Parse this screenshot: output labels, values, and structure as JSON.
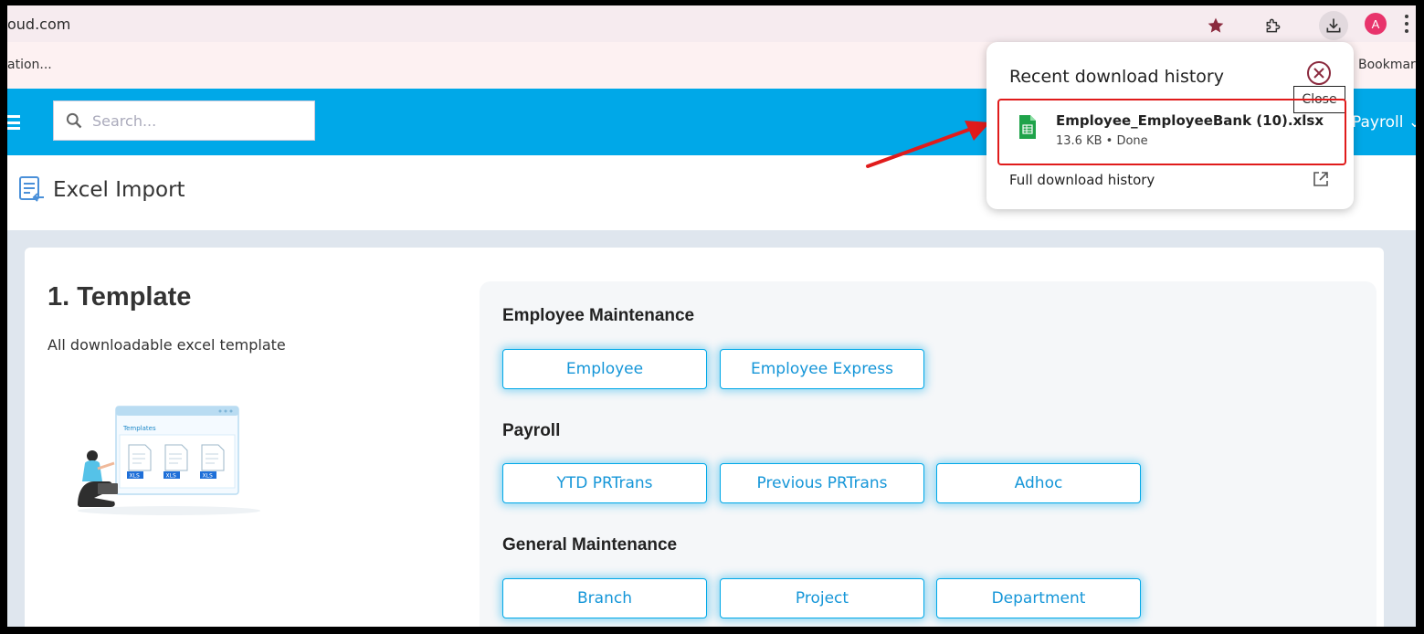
{
  "browser": {
    "url_fragment": "oud.com",
    "bookmarks_left": "ation...",
    "bookmarks_right": "Bookmark",
    "avatar_letter": "A",
    "accent": "#e8336b"
  },
  "header": {
    "search_placeholder": "Search...",
    "payroll_menu": "Payroll",
    "bar_color": "#00a8e8"
  },
  "page": {
    "title": "Excel Import"
  },
  "template_section": {
    "title": "1. Template",
    "description": "All downloadable excel template",
    "illustration_label": "Templates",
    "file_badge": "XLS"
  },
  "groups": [
    {
      "title": "Employee Maintenance",
      "buttons": [
        "Employee",
        "Employee Express"
      ]
    },
    {
      "title": "Payroll",
      "buttons": [
        "YTD PRTrans",
        "Previous PRTrans",
        "Adhoc"
      ]
    },
    {
      "title": "General Maintenance",
      "buttons": [
        "Branch",
        "Project",
        "Department"
      ]
    }
  ],
  "download_popup": {
    "title": "Recent download history",
    "close_tooltip": "Close",
    "file_name": "Employee_EmployeeBank (10).xlsx",
    "file_status": "13.6 KB • Done",
    "full_history": "Full download history",
    "highlight_color": "#e01b1b"
  }
}
